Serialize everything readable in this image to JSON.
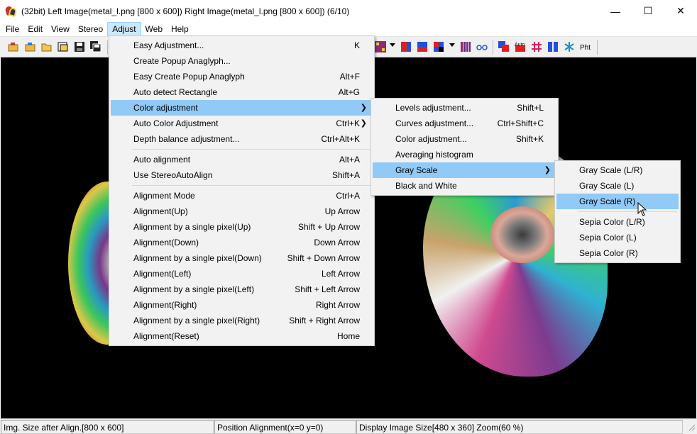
{
  "window": {
    "title": "(32bit) Left Image(metal_l.png [800 x 600]) Right Image(metal_l.png [800 x 600])  (6/10)",
    "minimize": "—",
    "maximize": "☐",
    "close": "✕"
  },
  "menubar": {
    "file": "File",
    "edit": "Edit",
    "view": "View",
    "stereo": "Stereo",
    "adjust": "Adjust",
    "web": "Web",
    "help": "Help"
  },
  "adjust_menu": {
    "items": [
      {
        "label": "Easy Adjustment...",
        "shortcut": "K"
      },
      {
        "label": "Create Popup Anaglyph...",
        "shortcut": ""
      },
      {
        "label": "Easy Create Popup Anaglyph",
        "shortcut": "Alt+F"
      },
      {
        "label": "Auto detect Rectangle",
        "shortcut": "Alt+G"
      },
      {
        "label": "Color adjustment",
        "shortcut": ""
      },
      {
        "label": "Auto Color Adjustment",
        "shortcut": "Ctrl+K"
      },
      {
        "label": "Depth balance adjustment...",
        "shortcut": "Ctrl+Alt+K"
      },
      {
        "label": "Auto alignment",
        "shortcut": "Alt+A"
      },
      {
        "label": "Use StereoAutoAlign",
        "shortcut": "Shift+A"
      },
      {
        "label": "Alignment Mode",
        "shortcut": "Ctrl+A"
      },
      {
        "label": "Alignment(Up)",
        "shortcut": "Up Arrow"
      },
      {
        "label": "Alignment by a single pixel(Up)",
        "shortcut": "Shift + Up Arrow"
      },
      {
        "label": "Alignment(Down)",
        "shortcut": "Down Arrow"
      },
      {
        "label": "Alignment by a single pixel(Down)",
        "shortcut": "Shift + Down Arrow"
      },
      {
        "label": "Alignment(Left)",
        "shortcut": "Left Arrow"
      },
      {
        "label": "Alignment by a single pixel(Left)",
        "shortcut": "Shift + Left Arrow"
      },
      {
        "label": "Alignment(Right)",
        "shortcut": "Right Arrow"
      },
      {
        "label": "Alignment by a single pixel(Right)",
        "shortcut": "Shift + Right Arrow"
      },
      {
        "label": "Alignment(Reset)",
        "shortcut": "Home"
      }
    ]
  },
  "color_menu": {
    "items": [
      {
        "label": "Levels adjustment...",
        "shortcut": "Shift+L"
      },
      {
        "label": "Curves adjustment...",
        "shortcut": "Ctrl+Shift+C"
      },
      {
        "label": "Color adjustment...",
        "shortcut": "Shift+K"
      },
      {
        "label": "Averaging histogram",
        "shortcut": ""
      },
      {
        "label": "Gray Scale",
        "shortcut": ""
      },
      {
        "label": "Black and White",
        "shortcut": ""
      }
    ]
  },
  "gray_menu": {
    "items": [
      {
        "label": "Gray Scale (L/R)"
      },
      {
        "label": "Gray Scale (L)"
      },
      {
        "label": "Gray Scale (R)"
      },
      {
        "label": "Sepia Color (L/R)"
      },
      {
        "label": "Sepia Color (L)"
      },
      {
        "label": "Sepia Color (R)"
      }
    ]
  },
  "toolbar": {
    "auto_label": "Auto",
    "pht_label": "Pht"
  },
  "statusbar": {
    "img_size": "Img. Size after Align.[800 x 600]",
    "position": "Position Alignment(x=0 y=0)",
    "display": "Display Image Size[480 x 360]  Zoom(60 %)"
  },
  "colors": {
    "menu_highlight": "#91c9f7",
    "menubar_active": "#cce8ff",
    "canvas": "#000000"
  }
}
